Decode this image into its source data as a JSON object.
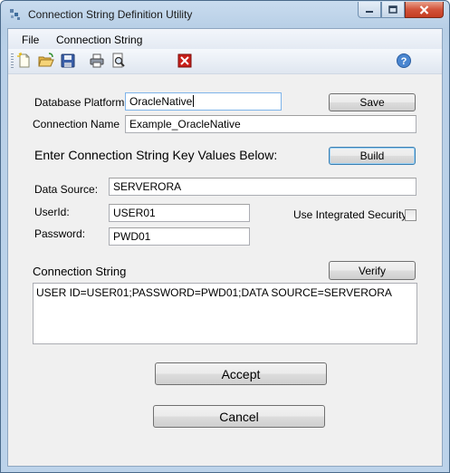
{
  "window": {
    "title": "Connection String Definition Utility"
  },
  "menu": {
    "file": "File",
    "connection_string": "Connection String"
  },
  "toolbar": {
    "icons": [
      "new-icon",
      "open-icon",
      "save-icon",
      "print-icon",
      "print-preview-icon",
      "exit-icon",
      "help-icon"
    ]
  },
  "form": {
    "database_platform": {
      "label": "Database Platform",
      "value": "OracleNative"
    },
    "save_label": "Save",
    "connection_name": {
      "label": "Connection Name",
      "value": "Example_OracleNative"
    },
    "enter_keys_heading": "Enter Connection String Key Values Below:",
    "build_label": "Build",
    "data_source": {
      "label": "Data Source:",
      "value": "SERVERORA"
    },
    "user_id": {
      "label": "UserId:",
      "value": "USER01"
    },
    "integrated_security": {
      "label": "Use Integrated Security:",
      "checked": false
    },
    "password": {
      "label": "Password:",
      "value": "PWD01"
    },
    "connection_string": {
      "label": "Connection String",
      "value": "USER ID=USER01;PASSWORD=PWD01;DATA SOURCE=SERVERORA"
    },
    "verify_label": "Verify",
    "accept_label": "Accept",
    "cancel_label": "Cancel"
  },
  "colors": {
    "frame": "#b9d0e8",
    "client": "#f0f0f0",
    "default_button_border": "#3c7fb1",
    "close_button": "#c53d22"
  }
}
